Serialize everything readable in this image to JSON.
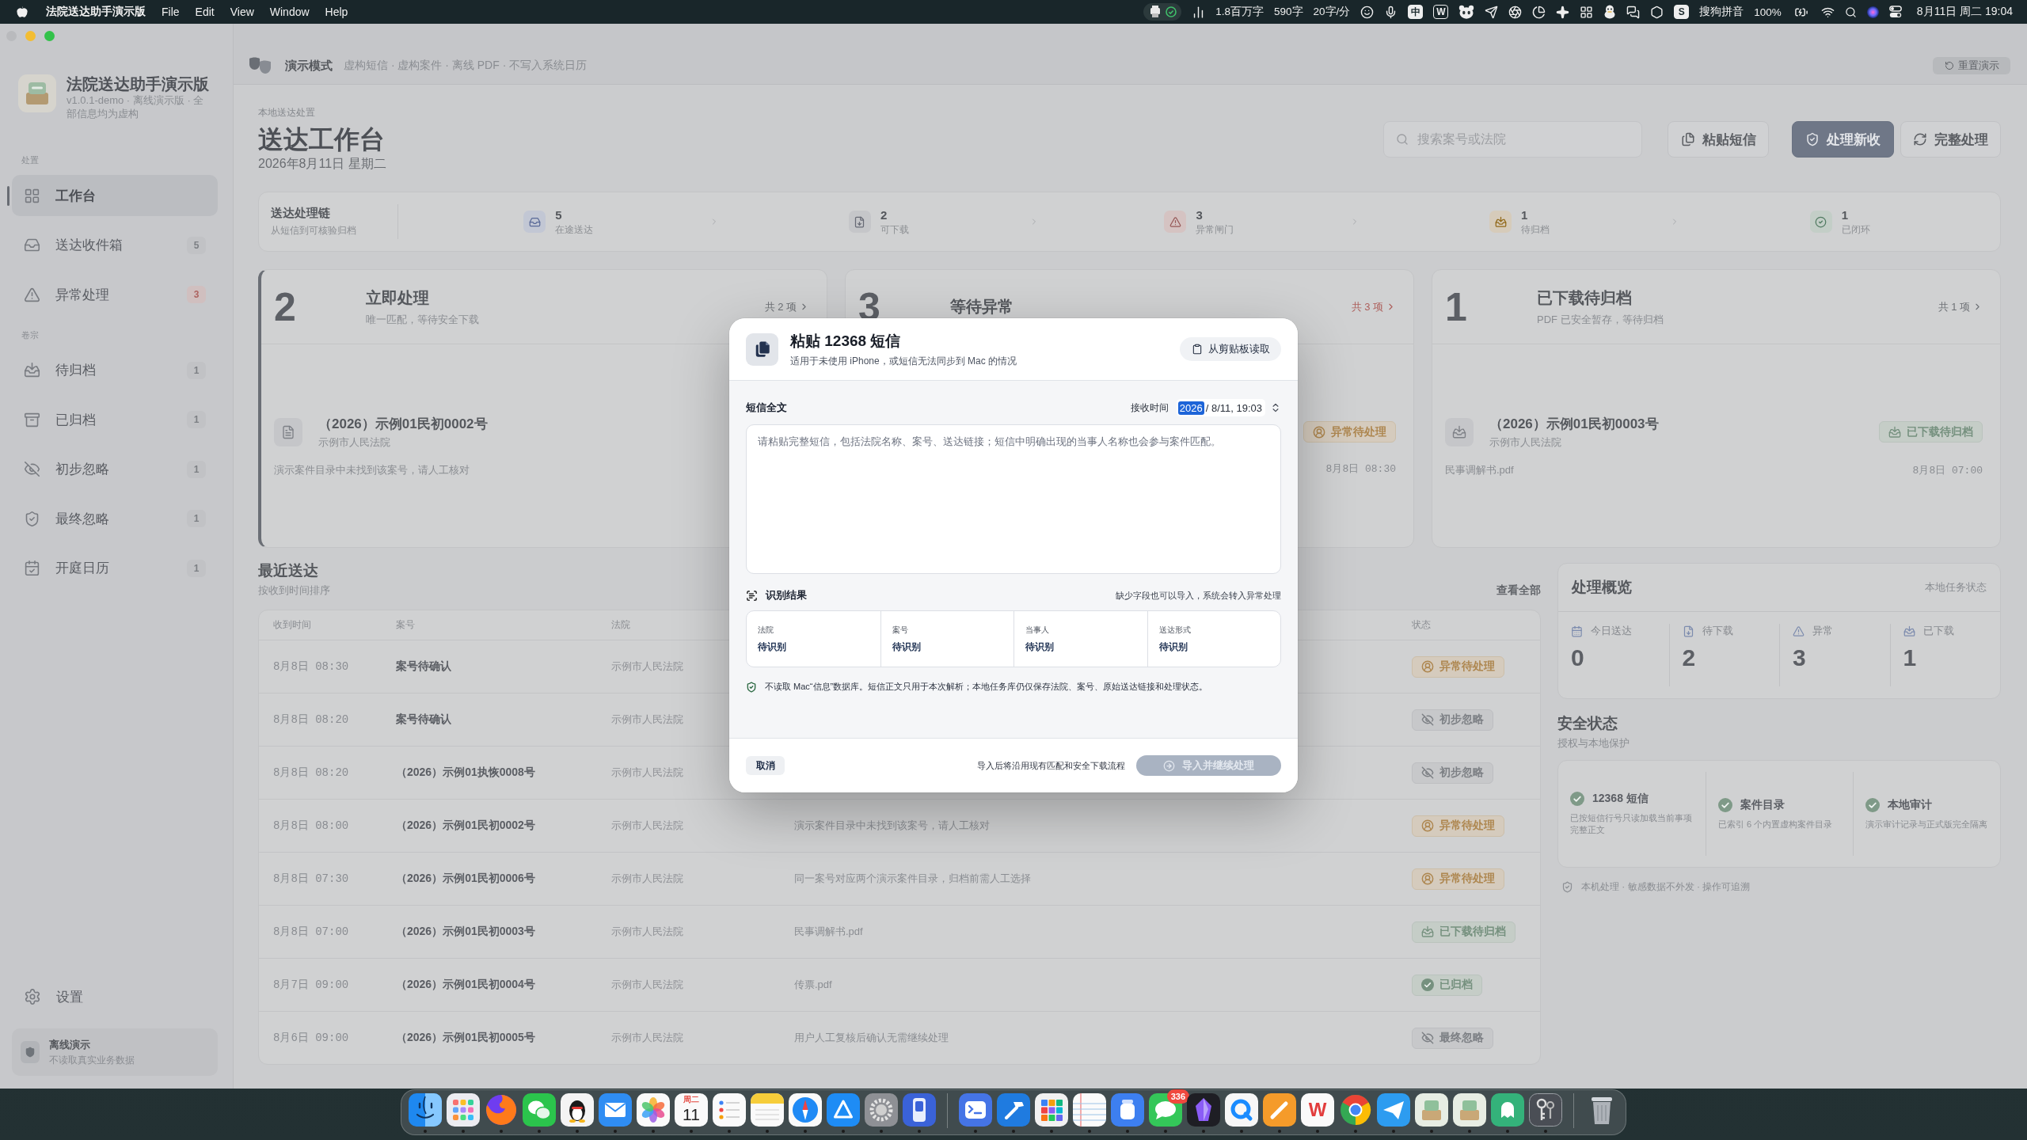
{
  "menu_bar": {
    "app_name": "法院送达助手演示版",
    "menus": [
      "File",
      "Edit",
      "View",
      "Window",
      "Help"
    ],
    "counters": [
      "1.8百万字",
      "590字",
      "20字/分"
    ],
    "input_mode": "中",
    "letter_badge": "W",
    "input_method_logo": "S",
    "input_method": "搜狗拼音",
    "battery": "100%",
    "clock": "8月11日 周二 19:04"
  },
  "sidebar": {
    "app_title": "法院送达助手演示版",
    "app_subtitle": "v1.0.1-demo · 离线演示版 · 全部信息均为虚构",
    "sections": [
      {
        "title": "处置",
        "items": [
          {
            "label": "工作台",
            "selected": true
          },
          {
            "label": "送达收件箱",
            "selected": false,
            "badge": {
              "text": "5",
              "alert": false
            }
          },
          {
            "label": "异常处理",
            "selected": false,
            "badge": {
              "text": "3",
              "alert": true
            }
          }
        ]
      },
      {
        "title": "卷宗",
        "items": [
          {
            "label": "待归档",
            "selected": false,
            "badge": {
              "text": "1",
              "alert": false
            }
          },
          {
            "label": "已归档",
            "selected": false,
            "badge": {
              "text": "1",
              "alert": false
            }
          },
          {
            "label": "初步忽略",
            "selected": false,
            "badge": {
              "text": "1",
              "alert": false
            }
          },
          {
            "label": "最终忽略",
            "selected": false,
            "badge": {
              "text": "1",
              "alert": false
            }
          },
          {
            "label": "开庭日历",
            "selected": false,
            "badge": {
              "text": "1",
              "alert": false
            }
          }
        ]
      }
    ],
    "settings": "设置",
    "footer": {
      "title": "离线演示",
      "subtitle": "不读取真实业务数据"
    }
  },
  "toolbar": {
    "mode": "演示模式",
    "note": "虚构短信 · 虚构案件 · 离线 PDF · 不写入系统日历",
    "reset_button": "重置演示"
  },
  "header": {
    "eyebrow": "本地送达处置",
    "title": "送达工作台",
    "date": "2026年8月11日 星期二",
    "search": {
      "placeholder": "搜索案号或法院"
    },
    "buttons": [
      {
        "label": "粘贴短信",
        "kind": "secondary"
      },
      {
        "label": "处理新收",
        "kind": "primary"
      },
      {
        "label": "完整处理",
        "kind": "secondary"
      }
    ]
  },
  "pipeline": {
    "title": "送达处理链",
    "subtitle": "从短信到可核验归档",
    "stages": [
      {
        "count": "5",
        "label": "在途送达",
        "color": "#c2c7d4"
      },
      {
        "count": "2",
        "label": "可下载",
        "color": "#c5c6c9"
      },
      {
        "count": "3",
        "label": "异常闸门",
        "color": "#d5c3c2"
      },
      {
        "count": "1",
        "label": "待归档",
        "color": "#d6cbba"
      },
      {
        "count": "1",
        "label": "已闭环",
        "color": "#c3cec7"
      }
    ]
  },
  "cards": [
    {
      "count": "2",
      "title": "立即处理",
      "subtitle": "唯一匹配，等待安全下载",
      "total": "共 2 项",
      "selected": true,
      "alert": false,
      "item": {
        "case": "（2026）示例01民初0002号",
        "court": "示例市人民法院",
        "note": "演示案件目录中未找到该案号，请人工核对"
      }
    },
    {
      "count": "3",
      "title": "等待异常",
      "total": "共 3 项",
      "selected": false,
      "alert": true,
      "item": {
        "status": {
          "kind": "exception",
          "label": "异常待处理"
        },
        "time": "8月8日 08:30"
      }
    },
    {
      "count": "1",
      "title": "已下载待归档",
      "subtitle": "PDF 已安全暂存，等待归档",
      "total": "共 1 项",
      "selected": false,
      "alert": false,
      "item": {
        "case": "（2026）示例01民初0003号",
        "court": "示例市人民法院",
        "status": {
          "kind": "downloaded",
          "label": "已下载待归档"
        },
        "note": "民事调解书.pdf",
        "time": "8月8日 07:00"
      }
    }
  ],
  "recent": {
    "title": "最近送达",
    "subtitle": "按收到时间排序",
    "view_all": "查看全部",
    "columns": {
      "received": "收到时间",
      "case": "案号",
      "court": "法院",
      "status": "状态"
    },
    "rows": [
      {
        "received": "8月8日 08:30",
        "case": "案号待确认",
        "court": "示例市人民法院",
        "status": {
          "kind": "exception",
          "label": "异常待处理"
        }
      },
      {
        "received": "8月8日 08:20",
        "case": "案号待确认",
        "court": "示例市人民法院",
        "status": {
          "kind": "ignored",
          "label": "初步忽略"
        }
      },
      {
        "received": "8月8日 08:20",
        "case": "（2026）示例01执恢0008号",
        "court": "示例市人民法院",
        "status": {
          "kind": "ignored",
          "label": "初步忽略"
        }
      },
      {
        "received": "8月8日 08:00",
        "case": "（2026）示例01民初0002号",
        "court": "示例市人民法院",
        "column_4": "演示案件目录中未找到该案号，请人工核对",
        "status": {
          "kind": "exception",
          "label": "异常待处理"
        }
      },
      {
        "received": "8月8日 07:30",
        "case": "（2026）示例01民初0006号",
        "court": "示例市人民法院",
        "column_4": "同一案号对应两个演示案件目录，归档前需人工选择",
        "status": {
          "kind": "exception",
          "label": "异常待处理"
        }
      },
      {
        "received": "8月8日 07:00",
        "case": "（2026）示例01民初0003号",
        "court": "示例市人民法院",
        "column_4": "民事调解书.pdf",
        "status": {
          "kind": "downloaded",
          "label": "已下载待归档"
        }
      },
      {
        "received": "8月7日 09:00",
        "case": "（2026）示例01民初0004号",
        "court": "示例市人民法院",
        "column_4": "传票.pdf",
        "status": {
          "kind": "archived",
          "label": "已归档"
        }
      },
      {
        "received": "8月6日 09:00",
        "case": "（2026）示例01民初0005号",
        "court": "示例市人民法院",
        "column_4": "用户人工复核后确认无需继续处理",
        "status": {
          "kind": "ignored",
          "label": "最终忽略"
        }
      }
    ]
  },
  "overview": {
    "title": "处理概览",
    "note": "本地任务状态",
    "stats": [
      {
        "label": "今日送达",
        "value": "0"
      },
      {
        "label": "待下载",
        "value": "2"
      },
      {
        "label": "异常",
        "value": "3"
      },
      {
        "label": "已下载",
        "value": "1"
      }
    ]
  },
  "security": {
    "title": "安全状态",
    "subtitle": "授权与本地保护",
    "items": [
      {
        "title": "12368 短信",
        "description": "已按短信行号只读加载当前事项完整正文"
      },
      {
        "title": "案件目录",
        "description": "已索引 6 个内置虚构案件目录"
      },
      {
        "title": "本地审计",
        "description": "演示审计记录与正式版完全隔离"
      }
    ],
    "footer": "本机处理 · 敏感数据不外发 · 操作可追溯"
  },
  "modal": {
    "title": "粘贴 12368 短信",
    "subtitle": "适用于未使用 iPhone，或短信无法同步到 Mac 的情况",
    "clipboard_button": "从剪贴板读取",
    "message_label": "短信全文",
    "received_label": "接收时间",
    "received_time": {
      "segments": [
        {
          "text": "2026",
          "selected": true
        },
        {
          "text": "/ 8/11, 19:03",
          "selected": false
        }
      ]
    },
    "message_placeholder": "请粘贴完整短信，包括法院名称、案号、送达链接；短信中明确出现的当事人名称也会参与案件匹配。",
    "result_title": "识别结果",
    "result_hint": "缺少字段也可以导入，系统会转入异常处理",
    "fields": [
      {
        "label": "法院",
        "value": "待识别"
      },
      {
        "label": "案号",
        "value": "待识别"
      },
      {
        "label": "当事人",
        "value": "待识别"
      },
      {
        "label": "送达形式",
        "value": "待识别"
      }
    ],
    "privacy_note": "不读取 Mac“信息”数据库。短信正文只用于本次解析；本地任务库仍仅保存法院、案号、原始送达链接和处理状态。",
    "cancel_button": "取消",
    "footer_note": "导入后将沿用现有匹配和安全下载流程",
    "import_button": {
      "label": "导入并继续处理",
      "disabled": true
    }
  },
  "dock": {
    "groups": [
      {
        "apps": [
          {
            "kind": "face",
            "running": true
          },
          {
            "kind": "launcher",
            "running": true
          },
          {
            "kind": "globe",
            "running": true
          },
          {
            "kind": "chat",
            "running": true
          },
          {
            "kind": "penguin",
            "running": true
          },
          {
            "kind": "mail",
            "running": true
          },
          {
            "kind": "flower",
            "running": true
          },
          {
            "kind": "calendar",
            "weekday": "周二",
            "day": "11",
            "running": true
          },
          {
            "kind": "checklist",
            "running": true
          },
          {
            "kind": "notepad",
            "running": true
          },
          {
            "kind": "compass",
            "running": true
          },
          {
            "kind": "triangle",
            "running": true
          },
          {
            "kind": "gear",
            "running": true
          },
          {
            "kind": "remote",
            "running": true
          }
        ]
      },
      {
        "apps": [
          {
            "kind": "prompt",
            "running": true
          },
          {
            "kind": "hammer",
            "running": true
          },
          {
            "kind": "tiles",
            "running": true
          },
          {
            "kind": "paper",
            "running": true
          },
          {
            "kind": "jar",
            "running": true
          },
          {
            "kind": "messages",
            "badge": "336",
            "running": true
          },
          {
            "kind": "crystal",
            "running": true
          },
          {
            "kind": "ring",
            "running": true
          },
          {
            "kind": "pencil",
            "running": true
          },
          {
            "kind": "letter",
            "letter": "W",
            "running": true
          },
          {
            "kind": "browser",
            "running": true
          },
          {
            "kind": "plane",
            "running": true
          },
          {
            "kind": "tray",
            "running": true
          },
          {
            "kind": "tray",
            "running": true
          },
          {
            "kind": "ghost",
            "running": true
          },
          {
            "kind": "keys",
            "running": true
          }
        ]
      },
      {
        "apps": [
          {
            "kind": "trash",
            "running": false
          }
        ]
      }
    ]
  }
}
